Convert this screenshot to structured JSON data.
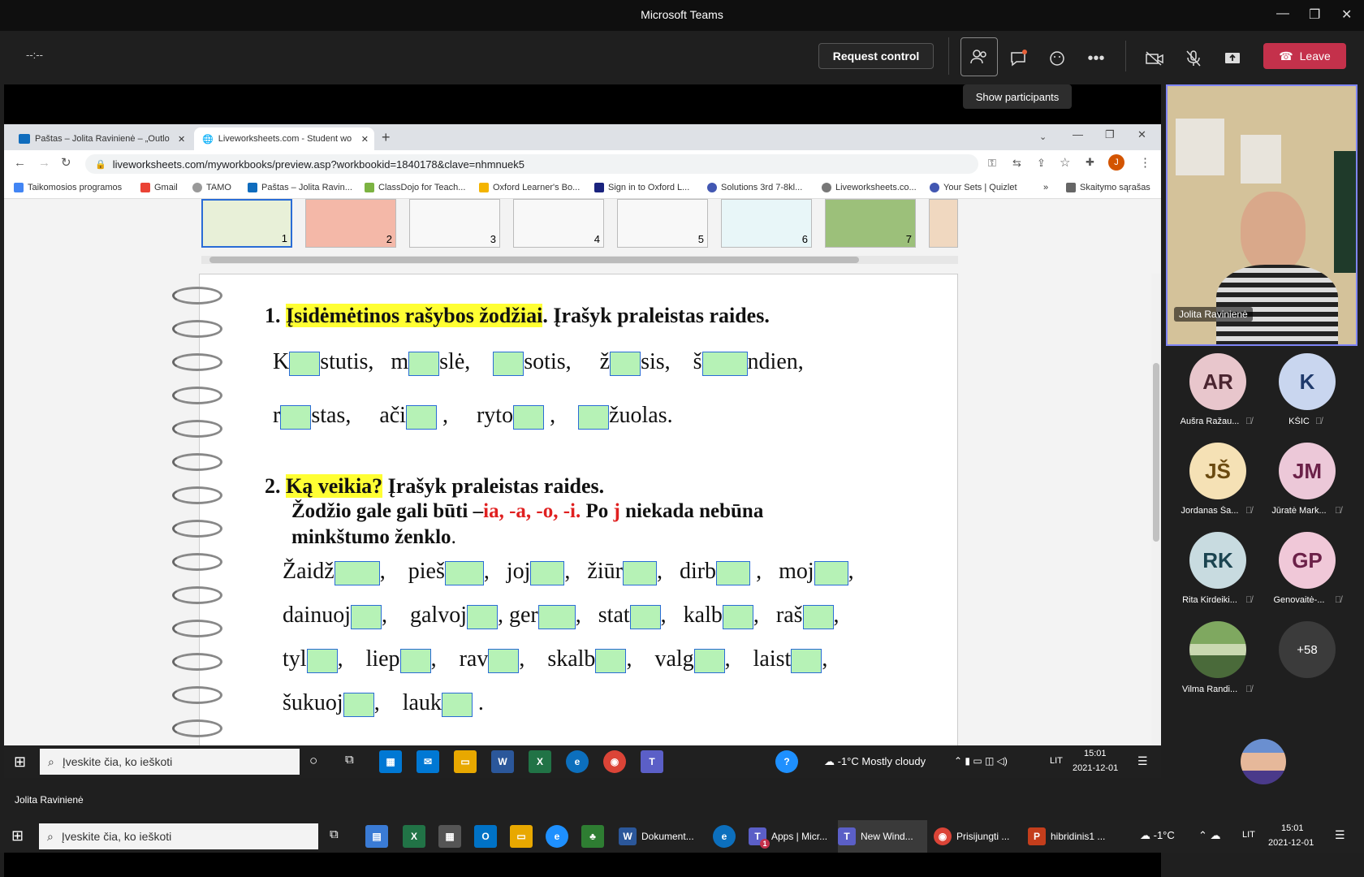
{
  "teams": {
    "title": "Microsoft Teams",
    "timer": "--:--",
    "request_control": "Request control",
    "leave": "Leave",
    "tooltip": "Show participants",
    "presenter_name": "Jolita Ravinienė"
  },
  "browser": {
    "tabs": [
      {
        "label": "Paštas – Jolita Ravinienė – „Outlo"
      },
      {
        "label": "Liveworksheets.com - Student wo"
      }
    ],
    "url": "liveworksheets.com/myworkbooks/preview.asp?workbookid=1840178&clave=nhmnuek5",
    "bookmarks": [
      "Taikomosios programos",
      "Gmail",
      "TAMO",
      "Paštas – Jolita Ravin...",
      "ClassDojo for Teach...",
      "Oxford Learner's Bo...",
      "Sign in to Oxford L...",
      "Solutions 3rd 7-8kl...",
      "Liveworksheets.co...",
      "Your Sets | Quizlet",
      "»",
      "Skaitymo sąrašas"
    ],
    "profile_initial": "J"
  },
  "thumbnails": [
    "1",
    "2",
    "3",
    "4",
    "5",
    "6",
    "7"
  ],
  "worksheet": {
    "q1_num": "1.",
    "q1_highlight": "Įsidėmėtinos rašybos žodžiai",
    "q1_rest": ". Įrašyk praleistas raides.",
    "q1_line1": [
      "K",
      "stutis,",
      "m",
      "slė,",
      "sotis,",
      "ž",
      "sis,",
      "š",
      "ndien,"
    ],
    "q1_line2": [
      "r",
      "stas,",
      "ači",
      ",",
      "ryto",
      ",",
      "žuolas."
    ],
    "q2_num": "2.",
    "q2_highlight": "Ką veikia?",
    "q2_rest": " Įrašyk praleistas raides.",
    "q2_sub_a": "Žodžio gale gali būti –",
    "q2_sub_endings": "ia,   -a,   -o,   -i.",
    "q2_sub_b": "  Po ",
    "q2_sub_j": "j",
    "q2_sub_c": " niekada nebūna",
    "q2_sub_d": "minkštumo ženklo",
    "q2_sub_dot": ".",
    "rows": [
      [
        "Žaidž",
        ",",
        "pieš",
        ",",
        "joj",
        ",",
        "žiūr",
        ",",
        "dirb",
        ",",
        "moj",
        ","
      ],
      [
        "dainuoj",
        ",",
        "galvoj",
        ", ger",
        ",",
        "stat",
        ",",
        "kalb",
        ",",
        "raš",
        ","
      ],
      [
        "tyl",
        ",",
        "liep",
        ",",
        "rav",
        ",",
        "skalb",
        ",",
        "valg",
        ",",
        "laist",
        ","
      ],
      [
        "šukuoj",
        ",",
        "lauk",
        "."
      ]
    ]
  },
  "taskbar_inner": {
    "search": "Įveskite čia, ko ieškoti",
    "weather": "-1°C  Mostly cloudy",
    "lang": "LIT",
    "time": "15:01",
    "date": "2021-12-01"
  },
  "taskbar_outer": {
    "search": "Įveskite čia, ko ieškoti",
    "apps": [
      "Dokument...",
      "Apps | Micr...",
      "New Wind...",
      "Prisijungti ...",
      "hibridinis1 ..."
    ],
    "badge": "1",
    "weather": "-1°C",
    "lang": "LIT",
    "time": "15:01",
    "date": "2021-12-01"
  },
  "participants": {
    "video_name": "Jolita Ravinienė",
    "list": [
      {
        "initials": "AR",
        "name": "Aušra Ražau...",
        "bg": "#e8c6cc",
        "fg": "#4a2530"
      },
      {
        "initials": "K",
        "name": "KŠIC",
        "bg": "#c9d6ef",
        "fg": "#1f3a6b"
      },
      {
        "initials": "JŠ",
        "name": "Jordanas Ša...",
        "bg": "#f5e1b5",
        "fg": "#6b4a10"
      },
      {
        "initials": "JM",
        "name": "Jūratė Mark...",
        "bg": "#ecc8d8",
        "fg": "#6b2148"
      },
      {
        "initials": "RK",
        "name": "Rita Kirdeiki...",
        "bg": "#c8dbe0",
        "fg": "#1b4450"
      },
      {
        "initials": "GP",
        "name": "Genovaitė-...",
        "bg": "#f0c8d8",
        "fg": "#6b2148"
      },
      {
        "initials": "",
        "name": "Vilma Randi...",
        "bg": "#8fa878",
        "fg": "#fff"
      },
      {
        "initials": "+58",
        "name": "",
        "bg": "#3b3b3b",
        "fg": "#fff"
      }
    ]
  }
}
